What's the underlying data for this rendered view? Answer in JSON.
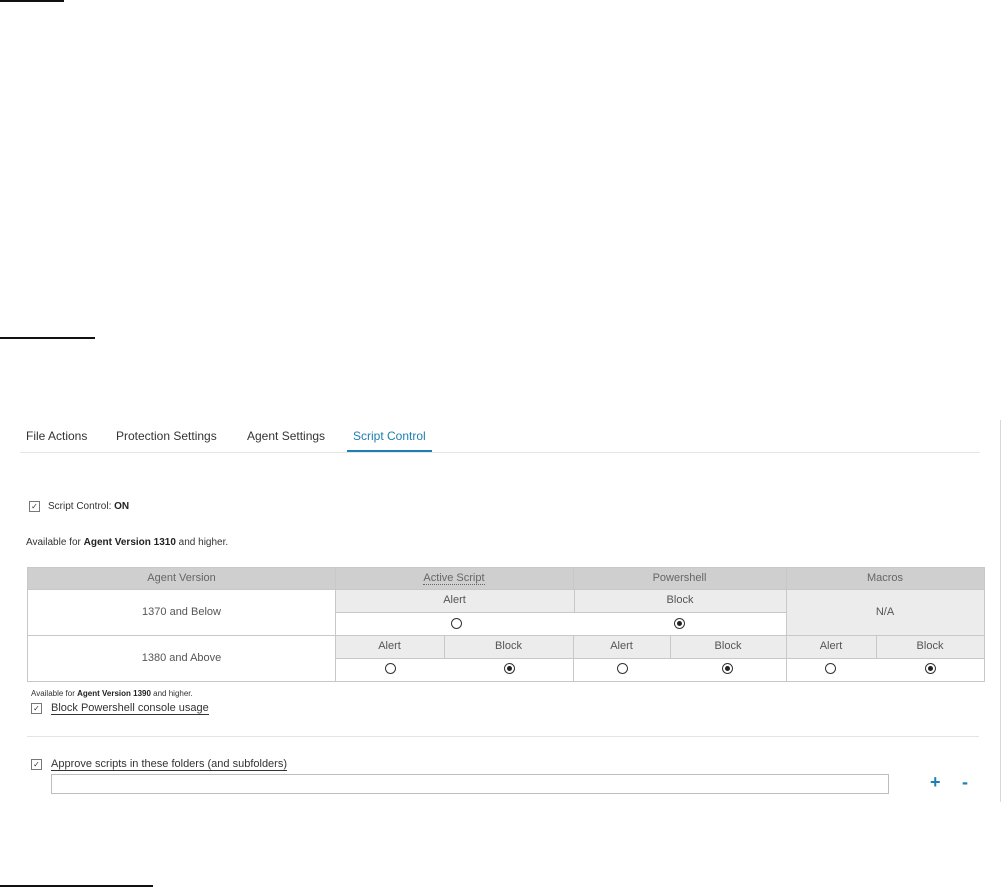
{
  "tabs": [
    {
      "label": "File Actions"
    },
    {
      "label": "Protection Settings"
    },
    {
      "label": "Agent Settings"
    },
    {
      "label": "Script Control"
    }
  ],
  "script_control": {
    "checkbox_label": "Script Control: ",
    "state": "ON",
    "checked": true
  },
  "availability": {
    "prefix": "Available for ",
    "bold": "Agent Version 1310",
    "suffix": " and higher."
  },
  "table": {
    "headers": [
      "Agent Version",
      "Active Script",
      "Powershell",
      "Macros"
    ],
    "rows": [
      {
        "version": "1370 and Below",
        "options": [
          "Alert",
          "Block"
        ],
        "macros": "N/A"
      },
      {
        "version": "1380 and Above",
        "active_script": [
          "Alert",
          "Block"
        ],
        "powershell": [
          "Alert",
          "Block"
        ],
        "macros": [
          "Alert",
          "Block"
        ]
      }
    ]
  },
  "availability2": {
    "prefix": "Available for ",
    "bold": "Agent Version 1390",
    "suffix": " and higher."
  },
  "block_powershell": {
    "label": "Block Powershell console usage",
    "checked": true
  },
  "approve_scripts": {
    "label": "Approve scripts in these folders (and subfolders)",
    "checked": true,
    "folder_value": "",
    "add_label": "+",
    "remove_label": "-"
  },
  "colors": {
    "accent": "#1d7fb3",
    "header_bg": "#cfcfcf",
    "subheader_bg": "#ececec"
  }
}
